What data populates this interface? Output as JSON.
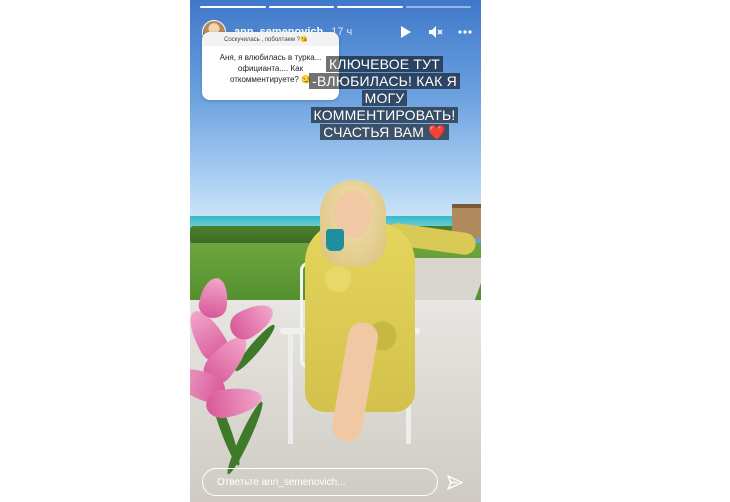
{
  "story": {
    "progress": {
      "segments_total": 4,
      "segments_done": 3
    },
    "header": {
      "username": "ann_semenovich",
      "time": "17 ч",
      "actions": [
        "play-icon",
        "mute-icon",
        "more-icon"
      ]
    },
    "question_sticker": {
      "prompt": "Соскучилась , поболтаем ?😘",
      "text": "Аня, я влюбилась в турка... официанта.... Как откомментируете? 😏"
    },
    "overlay_text": [
      "КЛЮЧЕВОЕ ТУТ",
      "-ВЛЮБИЛАСЬ! КАК Я",
      "МОГУ",
      "КОММЕНТИРОВАТЬ!",
      "СЧАСТЬЯ ВАМ ❤️"
    ],
    "reply": {
      "placeholder": "Ответьте ann_semenovich..."
    }
  },
  "colors": {
    "accent": "#ffffff",
    "overlay_bg": "#000000"
  }
}
